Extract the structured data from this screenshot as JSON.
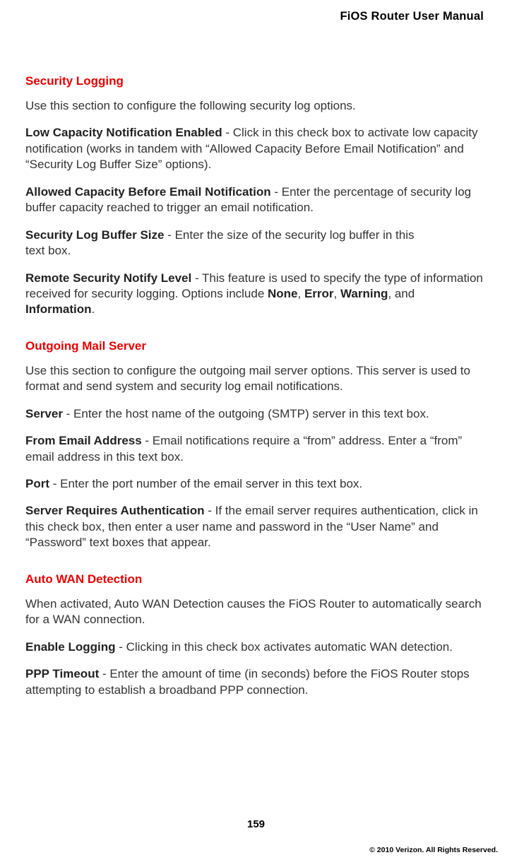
{
  "header": {
    "title": "FiOS Router User Manual"
  },
  "sections": {
    "security_logging": {
      "heading": "Security Logging",
      "intro": "Use this section to configure the following security log options.",
      "low_capacity": {
        "label": "Low Capacity Notification Enabled",
        "desc": " - Click in this check box to activate low capacity notification (works in tandem with “Allowed Capacity Before Email Notification” and “Security Log Buffer Size” options)."
      },
      "allowed_capacity": {
        "label": "Allowed Capacity Before Email Notification",
        "desc": " - Enter the percentage of security log buffer capacity reached to trigger an email notification."
      },
      "buffer_size": {
        "label": "Security Log Buffer Size",
        "desc_pre": " - Enter the size of the security log buffer in this",
        "desc_line2": "text box."
      },
      "notify_level": {
        "label": "Remote Security Notify Level",
        "desc_pre": " - This feature is used to specify the type of information received for security logging. Options include ",
        "opt1": "None",
        "sep1": ", ",
        "opt2": "Error",
        "sep2": ", ",
        "opt3": "Warning",
        "sep3": ", and ",
        "opt4": "Information",
        "tail": "."
      }
    },
    "outgoing_mail": {
      "heading": "Outgoing Mail Server",
      "intro": "Use this section to configure the outgoing mail server options. This server is used to format and send system and security log email notifications.",
      "server": {
        "label": "Server",
        "desc": " - Enter the host name of the outgoing (SMTP) server in this text box."
      },
      "from_email": {
        "label": "From Email Address",
        "desc": " - Email notifications require a “from” address. Enter a “from” email address in this text box."
      },
      "port": {
        "label": "Port",
        "desc": " - Enter the port number of the email server in this text box."
      },
      "auth": {
        "label": "Server Requires Authentication",
        "desc": " - If the email server requires authentication, click in this check box, then enter a user name and password in the “User Name” and “Password” text boxes that appear."
      }
    },
    "auto_wan": {
      "heading": "Auto WAN Detection",
      "intro": "When activated, Auto WAN Detection causes the FiOS Router to automatically search for a WAN connection.",
      "enable_logging": {
        "label": "Enable Logging",
        "desc": " - Clicking in this check box activates automatic WAN detection."
      },
      "ppp_timeout": {
        "label": "PPP Timeout",
        "desc": " - Enter the amount of time (in seconds) before the FiOS Router stops attempting to establish a broadband PPP connection."
      }
    }
  },
  "footer": {
    "page_number": "159",
    "copyright": "© 2010 Verizon. All Rights Reserved."
  }
}
